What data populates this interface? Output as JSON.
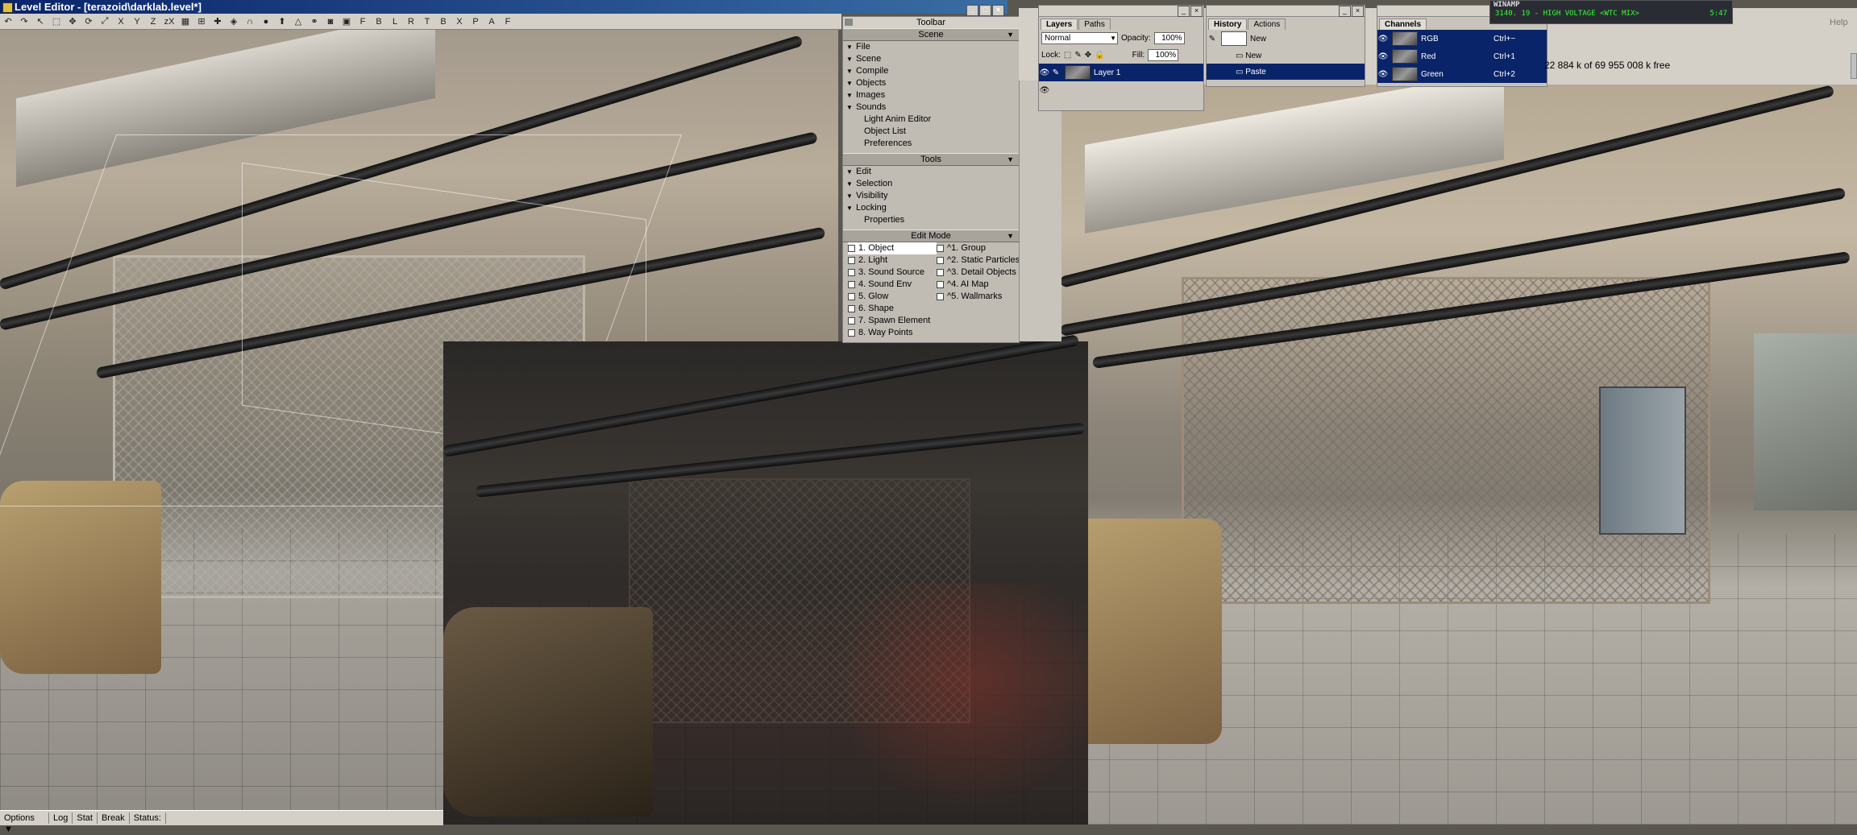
{
  "level_editor": {
    "title": "Level Editor - [terazoid\\darklab.level*]",
    "toolbar_letters": [
      "X",
      "Y",
      "Z",
      "zX"
    ],
    "snap_letters": [
      "F",
      "B",
      "L",
      "R",
      "T",
      "B",
      "X",
      "P",
      "A",
      "F"
    ],
    "status": {
      "options": "Options",
      "log": "Log",
      "stat": "Stat",
      "break": "Break",
      "status": "Status:"
    }
  },
  "side_panel": {
    "title": "Toolbar",
    "scene_header": "Scene",
    "scene_items": [
      "File",
      "Scene",
      "Compile",
      "Objects",
      "Images",
      "Sounds"
    ],
    "scene_plain": [
      "Light Anim Editor",
      "Object List",
      "Preferences"
    ],
    "tools_header": "Tools",
    "tools_items": [
      "Edit",
      "Selection",
      "Visibility",
      "Locking"
    ],
    "tools_plain": [
      "Properties"
    ],
    "edit_header": "Edit Mode",
    "edit_left": [
      "1. Object",
      "2. Light",
      "3. Sound Source",
      "4. Sound Env",
      "5. Glow",
      "6. Shape",
      "7. Spawn Element",
      "8. Way Points"
    ],
    "edit_right": [
      "^1. Group",
      "^2. Static Particles",
      "^3. Detail Objects",
      "^4. AI Map",
      "^5. Wallmarks"
    ]
  },
  "layers": {
    "tabs": [
      "Layers",
      "Paths"
    ],
    "blend": "Normal",
    "opacity_label": "Opacity:",
    "opacity": "100%",
    "lock_label": "Lock:",
    "fill_label": "Fill:",
    "fill": "100%",
    "layer_name": "Layer 1"
  },
  "history": {
    "tabs": [
      "History",
      "Actions"
    ],
    "snapshot": "New",
    "items": [
      "New",
      "Paste"
    ]
  },
  "channels": {
    "title": "Channels",
    "items": [
      {
        "name": "RGB",
        "key": "Ctrl+~"
      },
      {
        "name": "Red",
        "key": "Ctrl+1"
      },
      {
        "name": "Green",
        "key": "Ctrl+2"
      }
    ]
  },
  "winamp": {
    "title": "WINAMP",
    "track": "3140. 19 - HIGH VOLTAGE <WTC MIX>",
    "time": "5:47"
  },
  "memory": "22 884 k of 69 955 008 k free",
  "help": "Help"
}
